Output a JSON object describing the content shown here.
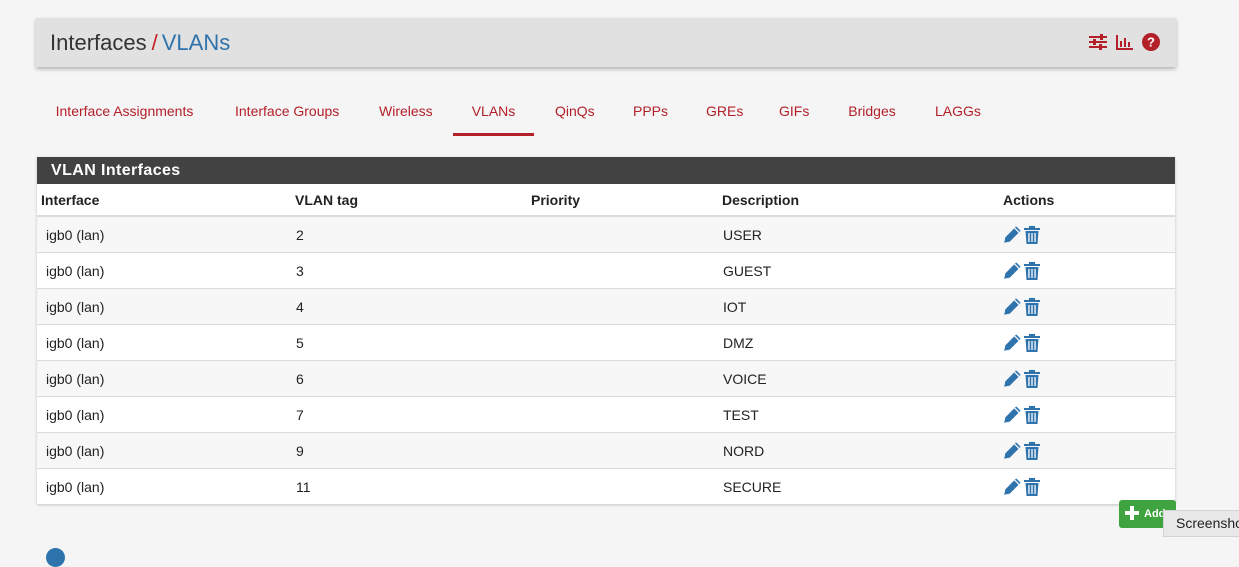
{
  "breadcrumb": {
    "root": "Interfaces",
    "separator": "/",
    "current": "VLANs"
  },
  "header_icons": [
    "sliders-icon",
    "bar-chart-icon",
    "help-icon"
  ],
  "tabs": [
    {
      "label": "Interface Assignments",
      "active": false
    },
    {
      "label": "Interface Groups",
      "active": false
    },
    {
      "label": "Wireless",
      "active": false
    },
    {
      "label": "VLANs",
      "active": true
    },
    {
      "label": "QinQs",
      "active": false
    },
    {
      "label": "PPPs",
      "active": false
    },
    {
      "label": "GREs",
      "active": false
    },
    {
      "label": "GIFs",
      "active": false
    },
    {
      "label": "Bridges",
      "active": false
    },
    {
      "label": "LAGGs",
      "active": false
    }
  ],
  "panel": {
    "title": "VLAN Interfaces",
    "columns": [
      "Interface",
      "VLAN tag",
      "Priority",
      "Description",
      "Actions"
    ],
    "rows": [
      {
        "interface": "igb0 (lan)",
        "tag": "2",
        "priority": "",
        "description": "USER"
      },
      {
        "interface": "igb0 (lan)",
        "tag": "3",
        "priority": "",
        "description": "GUEST"
      },
      {
        "interface": "igb0 (lan)",
        "tag": "4",
        "priority": "",
        "description": "IOT"
      },
      {
        "interface": "igb0 (lan)",
        "tag": "5",
        "priority": "",
        "description": "DMZ"
      },
      {
        "interface": "igb0 (lan)",
        "tag": "6",
        "priority": "",
        "description": "VOICE"
      },
      {
        "interface": "igb0 (lan)",
        "tag": "7",
        "priority": "",
        "description": "TEST"
      },
      {
        "interface": "igb0 (lan)",
        "tag": "9",
        "priority": "",
        "description": "NORD"
      },
      {
        "interface": "igb0 (lan)",
        "tag": "11",
        "priority": "",
        "description": "SECURE"
      }
    ],
    "row_actions": [
      "edit-pencil-icon",
      "delete-trash-icon"
    ]
  },
  "add_button": {
    "label": "Add"
  },
  "tooltip": {
    "text": "Screenshot"
  },
  "colors": {
    "brand_red": "#b3202a",
    "link_blue": "#2f73ad",
    "panel_heading": "#424242",
    "add_green": "#3fa33f"
  }
}
